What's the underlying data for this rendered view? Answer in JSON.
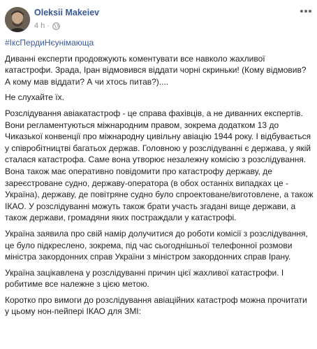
{
  "post": {
    "author": "Oleksii Makeiev",
    "time": "4 h",
    "dot": "·",
    "hashtag": "#ІксПердиНєунімающа",
    "paragraphs": [
      "Диванні експерти продовжують коментувати все навколо жахливої катастрофи. Зрада, Іран відмовився віддати чорні скриньки! (Кому відмовив? А кому мав віддати? А чи хтось питав?)....",
      "Не слухайте їх.",
      "Розслідування авіакатастроф - це справа фахівців, а не диванних експертів. Вони регламентуються міжнародним правом, зокрема додатком 13 до Чиказької конвенції про міжнародну цивільну авіацію 1944 року. І відбувається у співробітництві багатьох держав. Головною у розслідуванні є держава, у якій сталася катастрофа. Саме вона утворює незалежну комісію з розслідування. Вона також має оперативно повідомити про катастрофу державу, де зареєстроване судно, державу-оператора (в обох останніх випадках це - Україна), державу, де повітряне судно було спроектоване/виготовлене, а також ІКАО. У розслідуванні можуть також брати участь згадані вище держави, а також держави, громадяни яких постраждали у катастрофі.",
      "Україна заявила про свій намір долучитися до роботи комісії з розслідування, це було підкреслено, зокрема, під час сьогоднішньої телефонної розмови міністра закордонних справ України з міністром закордонних справ Ірану.",
      "Україна зацікавлена у розслідуванні причин цієї жахливої катастрофи. І робитиме все належне з цією метою.",
      "Коротко про вимоги до розслідування авіаційних катастроф можна прочитати у цьому нон-пейпері ІКАО для ЗМІ:"
    ]
  },
  "icons": {
    "globe": "globe-icon",
    "more": "more-options-icon"
  },
  "colors": {
    "link": "#385898",
    "text": "#1c1e21",
    "meta": "#90949c"
  }
}
